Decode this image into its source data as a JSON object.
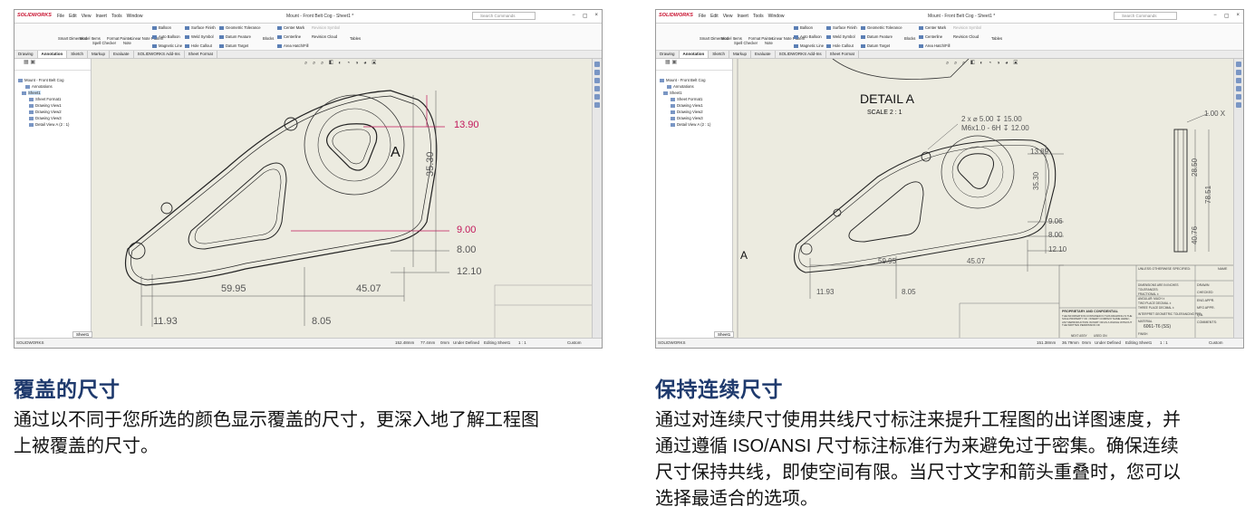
{
  "app": {
    "logo": "SOLIDWORKS",
    "menus": [
      "File",
      "Edit",
      "View",
      "Insert",
      "Tools",
      "Window"
    ],
    "search_placeholder": "Search Commands",
    "window_buttons": [
      "−",
      "▢",
      "×"
    ]
  },
  "ribbon": {
    "left_tools": [
      "Smart Dimension",
      "Model Items",
      "Spell Checker",
      "Format Painter",
      "Note",
      "Linear Note Pattern"
    ],
    "annotations": [
      "Balloon",
      "Auto Balloon",
      "Magnetic Line"
    ],
    "symbols": [
      "Surface Finish",
      "Weld Symbol",
      "Hole Callout"
    ],
    "tolerance": [
      "Geometric Tolerance",
      "Datum Feature",
      "Datum Target"
    ],
    "blocks": "Blocks",
    "center": [
      "Center Mark",
      "Centerline",
      "Area Hatch/Fill"
    ],
    "revision": [
      "Revision Symbol",
      "Revision Cloud"
    ],
    "tables": "Tables"
  },
  "tabs": [
    "Drawing",
    "Annotation",
    "Sketch",
    "Markup",
    "Evaluate",
    "SOLIDWORKS Add-Ins",
    "Sheet Format"
  ],
  "tree": {
    "items": [
      "Mount - Front Belt Cog",
      "Annotations",
      "Sheet1",
      "Sheet Format1",
      "Drawing View1",
      "Drawing View2",
      "Drawing View3",
      "Detail View A (2 : 1)"
    ]
  },
  "panels": {
    "left": {
      "title": "Mount - Front Belt Cog - Sheet1 *",
      "dims_overlay": [
        "13.90",
        "9.00"
      ],
      "dims": [
        "35.30",
        "8.00",
        "12.10",
        "59.95",
        "45.07",
        "11.93",
        "8.05"
      ],
      "detail_letter": "A",
      "sheet_tab": "Sheet1",
      "status": [
        "152.48mm",
        "77.4mm",
        "0mm",
        "Under Defined",
        "Editing Sheet1",
        "1 : 1",
        "Custom"
      ]
    },
    "right": {
      "title": "Mount - Front Belt Cog - Sheet1 *",
      "detail_title": "DETAIL A",
      "detail_scale": "SCALE 2 : 1",
      "hole_callout": [
        "2 x ⌀ 5.00 ↧ 15.00",
        "M6x1.0 - 6H ↧ 12.00"
      ],
      "dims": [
        "13.89",
        "35.30",
        "9.06",
        "8.00",
        "12.10",
        "59.95",
        "45.07",
        "11.93",
        "8.05"
      ],
      "side_dims": [
        "1.00 X",
        "28.50",
        "78.51",
        "40.76"
      ],
      "view_letter": "A",
      "title_block": {
        "unless": "UNLESS OTHERWISE SPECIFIED:",
        "name": "NAME",
        "rows": [
          "DRAWN",
          "CHECKED",
          "ENG APPR.",
          "MFG APPR.",
          "Q.A.",
          "COMMENTS:"
        ],
        "notes": [
          "DIMENSIONS ARE IN INCHES",
          "TOLERANCES:",
          "FRACTIONAL ±",
          "ANGULAR: MACH ±",
          "TWO PLACE DECIMAL ±",
          "THREE PLACE DECIMAL ±"
        ],
        "proprietary": "PROPRIETARY AND CONFIDENTIAL",
        "proprietary_text": "THE INFORMATION CONTAINED IN THIS DRAWING IS THE SOLE PROPERTY OF <INSERT COMPANY NAME HERE>. ANY REPRODUCTION IN PART OR AS A WHOLE WITHOUT THE WRITTEN PERMISSION OF",
        "interpret": "INTERPRET GEOMETRIC TOLERANCING PER:",
        "material": "MATERIAL",
        "finish": "FINISH",
        "part_no": "6061-T6 (SS)",
        "next_assy": "NEXT ASSY",
        "used_on": "USED ON"
      },
      "sheet_tab": "Sheet1",
      "status": [
        "151.38mm",
        "36.79mm",
        "0mm",
        "Under Defined",
        "Editing Sheet1",
        "1 : 1",
        "Custom"
      ]
    }
  },
  "sections": {
    "left": {
      "heading": "覆盖的尺寸",
      "lines": [
        "通过以不同于您所选的颜色显示覆盖的尺寸，更深入地了解工程图",
        "上被覆盖的尺寸。"
      ]
    },
    "right": {
      "heading": "保持连续尺寸",
      "lines": [
        "通过对连续尺寸使用共线尺寸标注来提升工程图的出详图速度，并",
        "通过遵循 ISO/ANSI 尺寸标注标准行为来避免过于密集。确保连续",
        "尺寸保持共线，即使空间有限。当尺寸文字和箭头重叠时，您可以",
        "选择最适合的选项。"
      ]
    }
  },
  "colors": {
    "heading": "#1f3a6d",
    "overlay_dim": "#c2185b",
    "canvas": "#ecebe0",
    "brand": "#c8102e"
  }
}
